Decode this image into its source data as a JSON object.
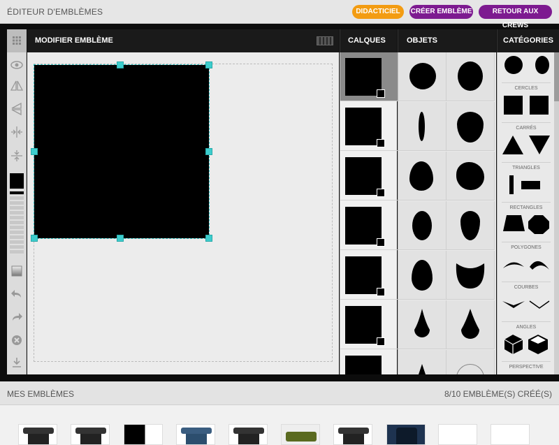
{
  "topbar": {
    "title": "ÉDITEUR D'EMBLÈMES",
    "buttons": {
      "tutorial": "DIDACTICIEL",
      "create": "CRÉER EMBLÈME",
      "back": "RETOUR AUX CREWS"
    },
    "colors": {
      "orange": "#f39c12",
      "purple": "#7d1a90"
    }
  },
  "editor": {
    "headers": {
      "edit": "MODIFIER EMBLÈME",
      "layers": "CALQUES",
      "layers_arrow": "▸▸",
      "objects": "OBJETS",
      "categories": "CATÉGORIES"
    },
    "tools": [
      "grid-icon",
      "eye-icon",
      "flip-horizontal-icon",
      "flip-vertical-icon",
      "align-horizontal-icon",
      "align-vertical-icon",
      "color-swatch",
      "opacity-slider",
      "gradient-icon",
      "undo-icon",
      "redo-icon",
      "delete-icon",
      "download-icon"
    ],
    "accent": "#3ccdcd"
  },
  "categories": [
    "CERCLES",
    "CARRÉS",
    "TRIANGLES",
    "RECTANGLES",
    "POLYGONES",
    "COURBES",
    "ANGLES",
    "PERSPECTIVE"
  ],
  "bottom": {
    "title": "MES EMBLÈMES",
    "count": "8/10 EMBLÈME(S) CRÉÉ(S)"
  }
}
